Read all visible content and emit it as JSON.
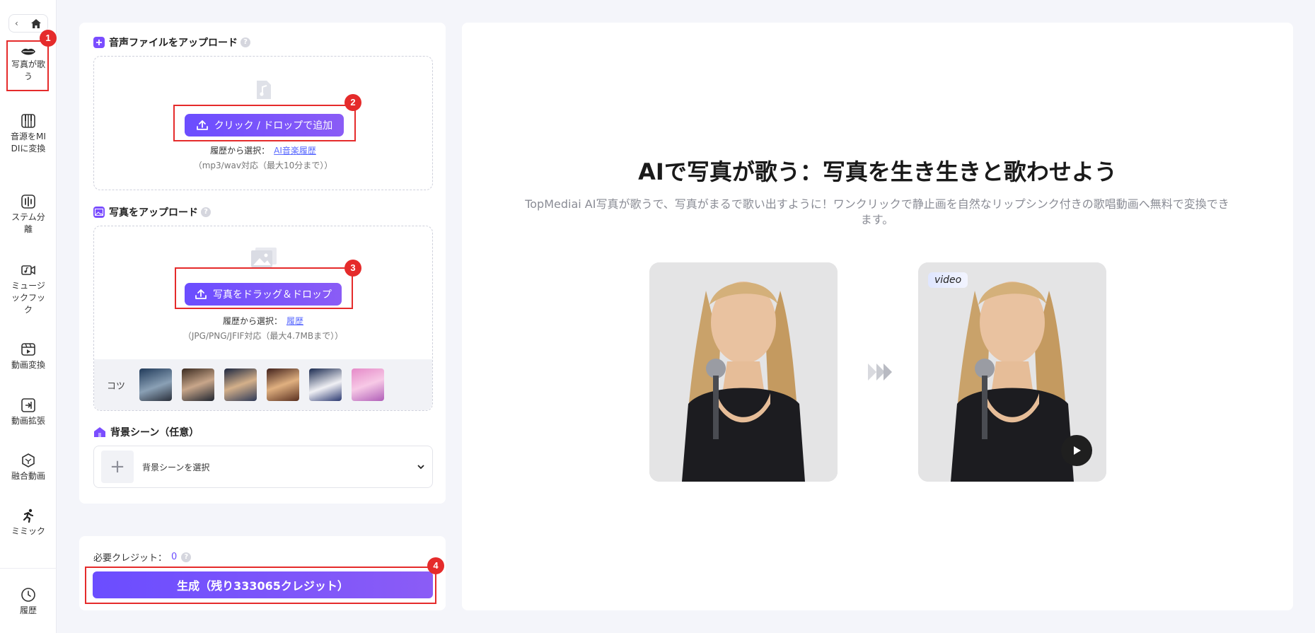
{
  "sidebar": {
    "back_glyph": "‹",
    "home_icon": "home-icon",
    "items": [
      {
        "label": "写真が歌う",
        "icon": "lips-icon"
      },
      {
        "label": "音源をMIDIに変換",
        "icon": "piano-icon"
      },
      {
        "label": "ステム分離",
        "icon": "stem-icon"
      },
      {
        "label": "ミュージックフック",
        "icon": "music-video-icon"
      },
      {
        "label": "動画変換",
        "icon": "video-convert-icon"
      },
      {
        "label": "動画拡張",
        "icon": "video-extend-icon"
      },
      {
        "label": "融合動画",
        "icon": "fusion-icon"
      },
      {
        "label": "ミミック",
        "icon": "running-icon"
      },
      {
        "label": "履歴",
        "icon": "clock-icon"
      }
    ]
  },
  "audio_section": {
    "title": "音声ファイルをアップロード",
    "button": "クリック / ドロップで追加",
    "history_prefix": "履歴から選択：",
    "history_link": "AI音楽履歴",
    "format_note": "（mp3/wav対応（最大10分まで））"
  },
  "photo_section": {
    "title": "写真をアップロード",
    "button": "写真をドラッグ＆ドロップ",
    "history_prefix": "履歴から選択：",
    "history_link": "履歴",
    "format_note": "（JPG/PNG/JFIF対応（最大4.7MBまで））",
    "tips_label": "コツ"
  },
  "scene_section": {
    "title": "背景シーン（任意）",
    "placeholder": "背景シーンを選択"
  },
  "generate": {
    "credits_label": "必要クレジット：",
    "credits_value": "0",
    "button": "生成（残り333065クレジット）"
  },
  "main": {
    "title": "AIで写真が歌う：写真を生き生きと歌わせよう",
    "description": "TopMediai AI写真が歌うで、写真がまるで歌い出すように！ワンクリックで静止画を自然なリップシンク付きの歌唱動画へ無料で変換できます。",
    "video_tag": "video"
  },
  "annotations": [
    "1",
    "2",
    "3",
    "4"
  ],
  "colors": {
    "accent": "#6b4dff",
    "annotation": "#e52b2b",
    "link": "#5b6bff"
  }
}
